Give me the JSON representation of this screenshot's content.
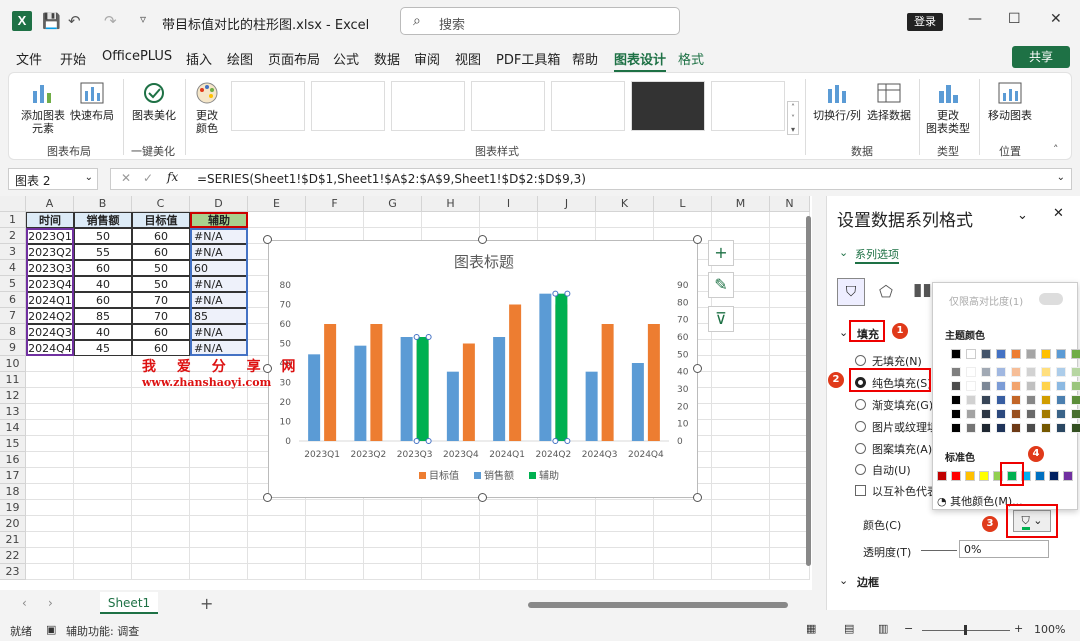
{
  "app": {
    "doc_title": "带目标值对比的柱形图.xlsx  -  Excel",
    "search_placeholder": "搜索",
    "login": "登录",
    "share": "共享"
  },
  "menu": [
    "文件",
    "开始",
    "OfficePLUS",
    "插入",
    "绘图",
    "页面布局",
    "公式",
    "数据",
    "审阅",
    "视图",
    "PDF工具箱",
    "帮助",
    "图表设计",
    "格式"
  ],
  "ribbon": {
    "add_element": "添加图表\n元素",
    "quick_layout": "快速布局",
    "group_layout": "图表布局",
    "beautify": "图表美化",
    "group_beautify": "一键美化",
    "change_color": "更改\n颜色",
    "group_styles": "图表样式",
    "switch_rowcol": "切换行/列",
    "select_data": "选择数据",
    "group_data": "数据",
    "change_type": "更改\n图表类型",
    "group_type": "类型",
    "move_chart": "移动图表",
    "group_position": "位置"
  },
  "formula_bar": {
    "name_box": "图表 2",
    "formula": "=SERIES(Sheet1!$D$1,Sheet1!$A$2:$A$9,Sheet1!$D$2:$D$9,3)"
  },
  "columns": [
    "A",
    "B",
    "C",
    "D",
    "E",
    "F",
    "G",
    "H",
    "I",
    "J",
    "K",
    "L",
    "M",
    "N"
  ],
  "rows": [
    "1",
    "2",
    "3",
    "4",
    "5",
    "6",
    "7",
    "8",
    "9",
    "10",
    "11",
    "12",
    "13",
    "14",
    "15",
    "16",
    "17",
    "18",
    "19",
    "20",
    "21",
    "22",
    "23"
  ],
  "table": {
    "headers": [
      "时间",
      "销售额",
      "目标值",
      "辅助"
    ],
    "rows": [
      [
        "2023Q1",
        "50",
        "60",
        "#N/A"
      ],
      [
        "2023Q2",
        "55",
        "60",
        "#N/A"
      ],
      [
        "2023Q3",
        "60",
        "50",
        "60"
      ],
      [
        "2023Q4",
        "40",
        "50",
        "#N/A"
      ],
      [
        "2024Q1",
        "60",
        "70",
        "#N/A"
      ],
      [
        "2024Q2",
        "85",
        "70",
        "85"
      ],
      [
        "2024Q3",
        "40",
        "60",
        "#N/A"
      ],
      [
        "2024Q4",
        "45",
        "60",
        "#N/A"
      ]
    ]
  },
  "watermark": {
    "line1": "我 爱 分 享 网",
    "line2": "www.zhanshaoyi.com"
  },
  "chart_data": {
    "type": "bar",
    "title": "图表标题",
    "categories": [
      "2023Q1",
      "2023Q2",
      "2023Q3",
      "2023Q4",
      "2024Q1",
      "2024Q2",
      "2024Q3",
      "2024Q4"
    ],
    "series": [
      {
        "name": "目标值",
        "values": [
          60,
          60,
          50,
          50,
          70,
          70,
          60,
          60
        ],
        "color": "#ed7d31",
        "axis": "primary"
      },
      {
        "name": "销售额",
        "values": [
          50,
          55,
          60,
          40,
          60,
          85,
          40,
          45
        ],
        "color": "#5b9bd5",
        "axis": "secondary"
      },
      {
        "name": "辅助",
        "values": [
          null,
          null,
          60,
          null,
          null,
          85,
          null,
          null
        ],
        "color": "#00b050",
        "axis": "secondary"
      }
    ],
    "ylim": [
      0,
      80
    ],
    "y_ticks": [
      "0",
      "10",
      "20",
      "30",
      "40",
      "50",
      "60",
      "70",
      "80"
    ],
    "y2lim": [
      0,
      90
    ],
    "y2_ticks": [
      "0",
      "10",
      "20",
      "30",
      "40",
      "50",
      "60",
      "70",
      "80",
      "90"
    ],
    "legend": "bottom",
    "grid": false
  },
  "sheet_tab": "Sheet1",
  "status": {
    "ready": "就绪",
    "accessibility": "辅助功能: 调查",
    "zoom": "100%"
  },
  "pane": {
    "title": "设置数据系列格式",
    "series_options": "系列选项",
    "fill": "填充",
    "options": [
      "无填充(N)",
      "纯色填充(S)",
      "渐变填充(G)",
      "图片或纹理填",
      "图案填充(A)",
      "自动(U)",
      "以互补色代表"
    ],
    "color_label": "颜色(C)",
    "transparency_label": "透明度(T)",
    "transparency": "0%",
    "border": "边框"
  },
  "palette": {
    "high_contrast": "仅限高对比度(1)",
    "theme_colors": "主题颜色",
    "standard_colors": "标准色",
    "more_colors": "其他颜色(M)..."
  },
  "badges": [
    "1",
    "2",
    "3",
    "4"
  ],
  "theme_row": [
    "#000000",
    "#ffffff",
    "#44546a",
    "#4472c4",
    "#ed7d31",
    "#a5a5a5",
    "#ffc000",
    "#5b9bd5",
    "#70ad47"
  ],
  "standard_colors": [
    "#c00000",
    "#ff0000",
    "#ffc000",
    "#ffff00",
    "#92d050",
    "#00b050",
    "#00b0f0",
    "#0070c0",
    "#002060",
    "#7030a0"
  ]
}
